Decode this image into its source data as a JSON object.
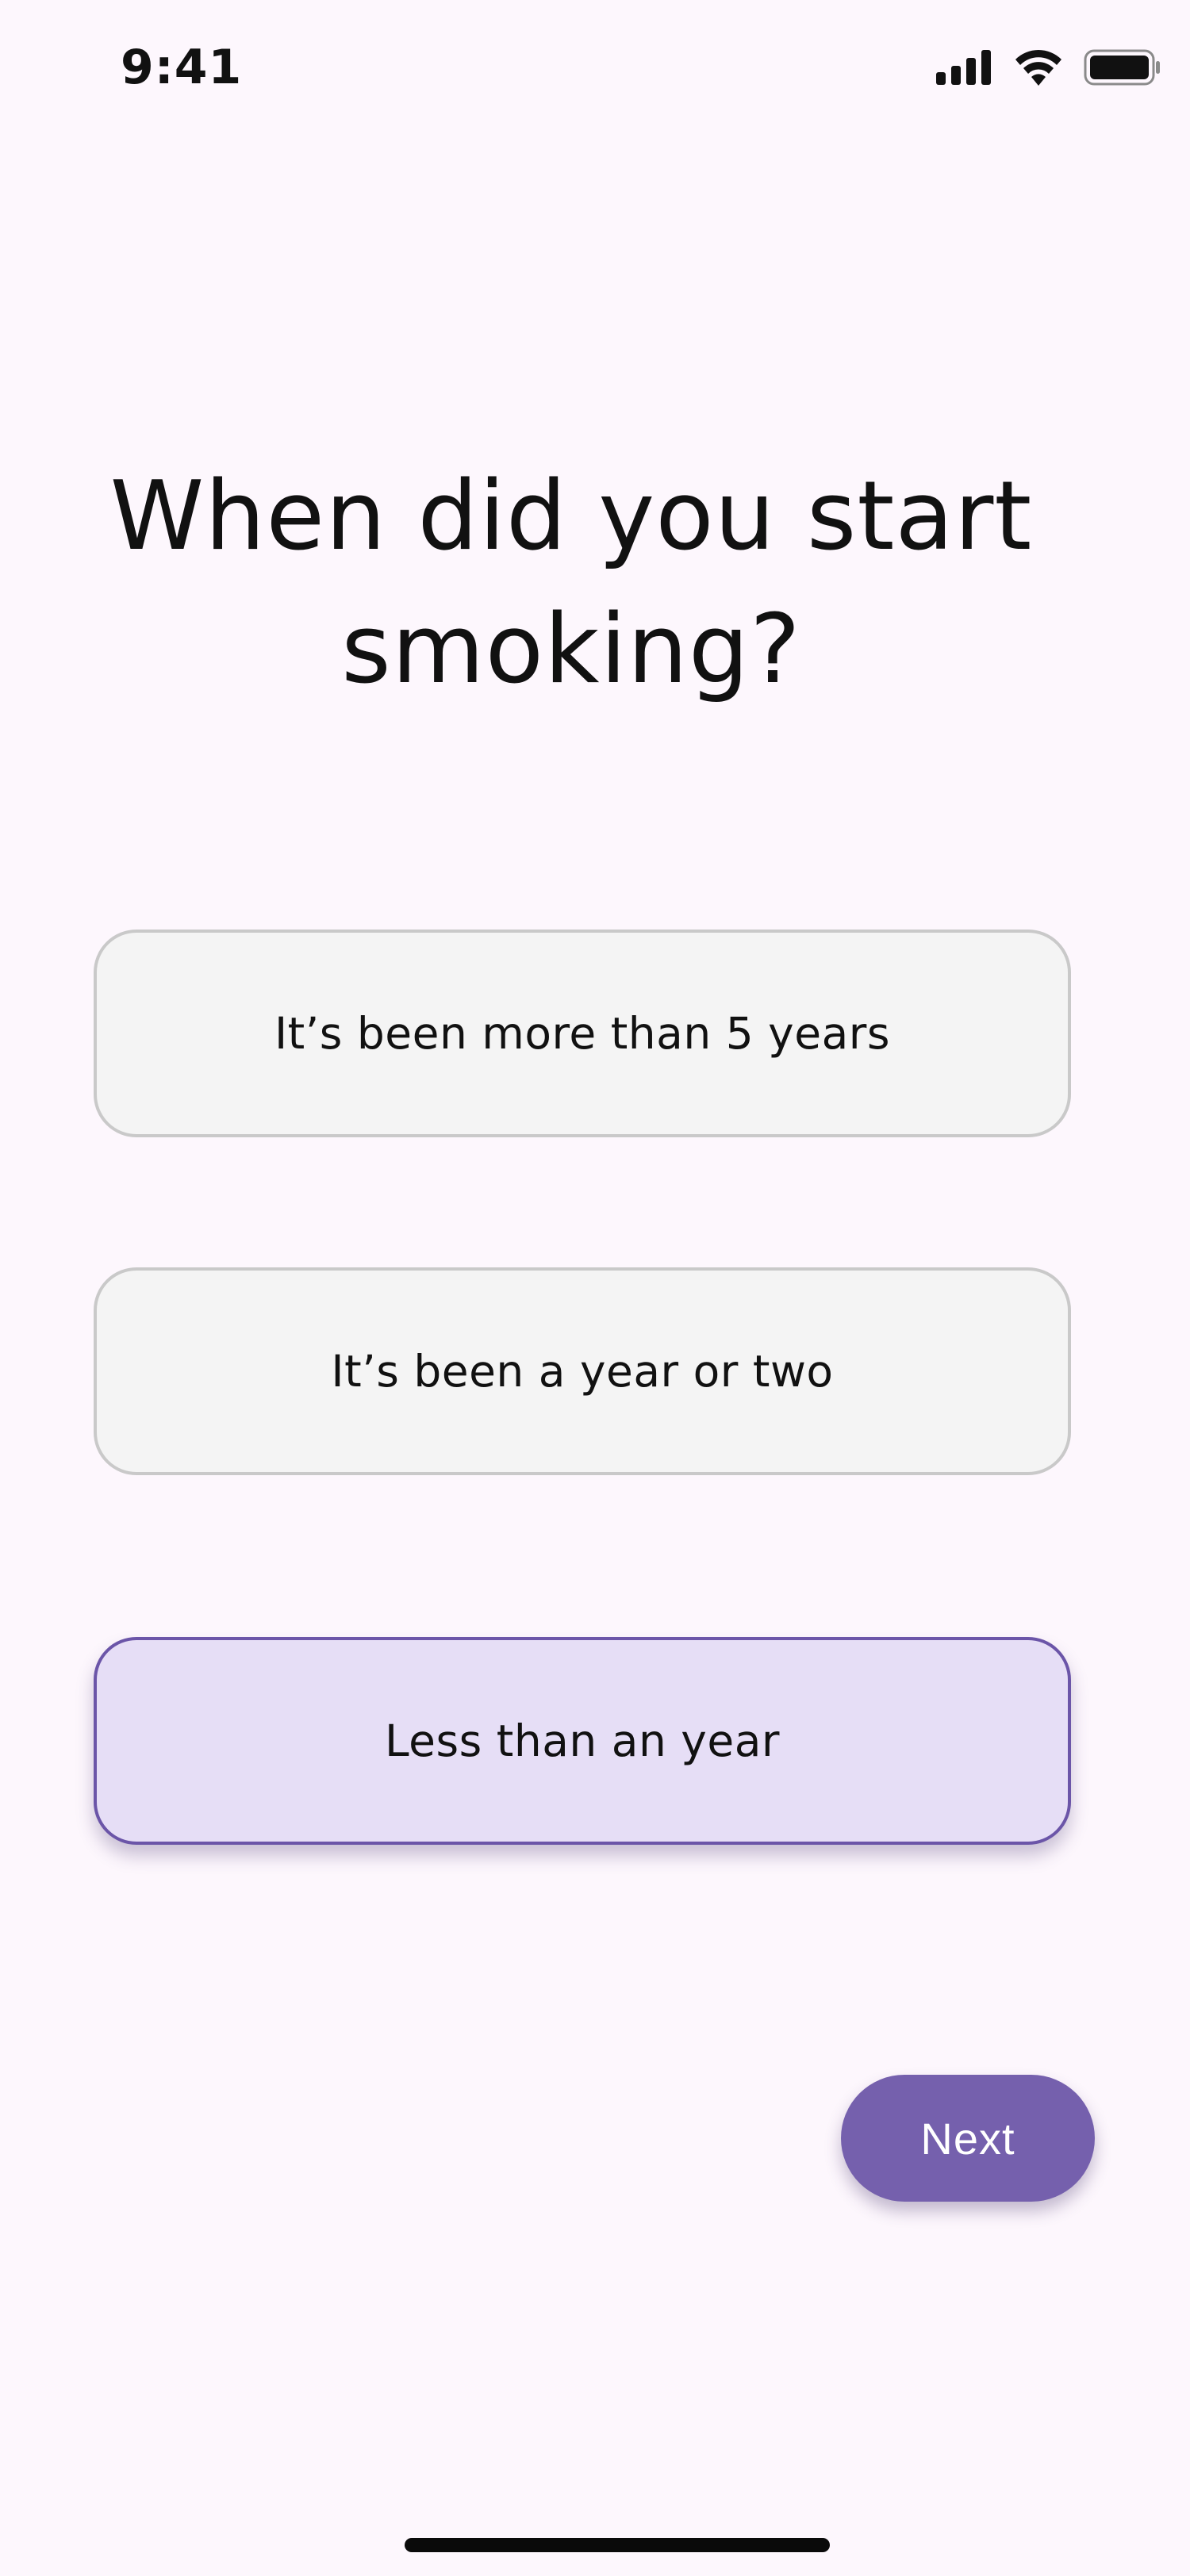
{
  "status_bar": {
    "time": "9:41",
    "icons": [
      "cellular-signal-icon",
      "wifi-icon",
      "battery-icon"
    ]
  },
  "question": {
    "title": "When did you start smoking?"
  },
  "options": [
    {
      "label": "It’s been more than 5 years",
      "selected": false
    },
    {
      "label": "It’s been a year or two",
      "selected": false
    },
    {
      "label": "Less than an year",
      "selected": true
    }
  ],
  "actions": {
    "next_label": "Next"
  },
  "colors": {
    "background": "#FDF7FD",
    "option_default_bg": "#F4F4F4",
    "option_default_border": "#C9C9C9",
    "option_selected_bg": "#E6DEF6",
    "option_selected_border": "#6B55A8",
    "accent": "#7560AD"
  }
}
